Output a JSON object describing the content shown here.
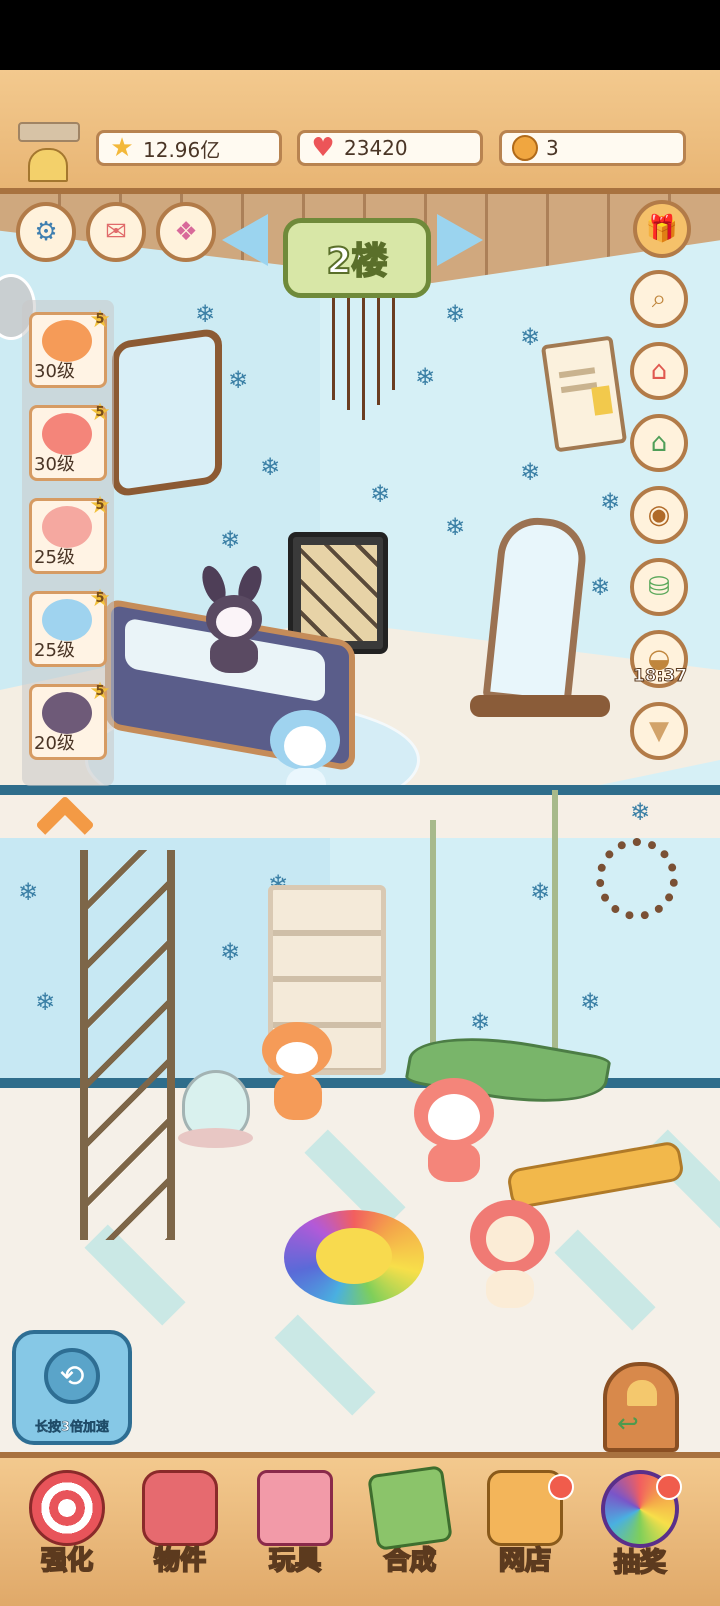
{
  "resources": {
    "stars": "12.96亿",
    "hearts": "23420",
    "coins": "3"
  },
  "floor": {
    "label": "2楼"
  },
  "pets": [
    {
      "level": "30级",
      "stars": "5",
      "color": "#f59b58"
    },
    {
      "level": "30级",
      "stars": "5",
      "color": "#f4857a"
    },
    {
      "level": "25级",
      "stars": "5",
      "color": "#f5a8a0"
    },
    {
      "level": "25级",
      "stars": "5",
      "color": "#9fd3ef"
    },
    {
      "level": "20级",
      "stars": "5",
      "color": "#6e5a78"
    }
  ],
  "timer": "18:37",
  "speed_button": "长按3倍加速",
  "nav": [
    {
      "label": "强化",
      "icon": "lollipop-icon",
      "color": "#e8545a"
    },
    {
      "label": "物件",
      "icon": "piano-icon",
      "color": "#e66a6f"
    },
    {
      "label": "玩具",
      "icon": "toy-house-icon",
      "color": "#f29aa8"
    },
    {
      "label": "合成",
      "icon": "cards-icon",
      "color": "#8bc46a"
    },
    {
      "label": "网店",
      "icon": "shop-basket-icon",
      "color": "#f3b55a"
    },
    {
      "label": "抽奖",
      "icon": "lottery-wheel-icon",
      "color": "#7a55c8"
    }
  ],
  "colors": {
    "wood": "#e8b574",
    "wall": "#cdebf3",
    "accent": "#2f6d8b"
  }
}
